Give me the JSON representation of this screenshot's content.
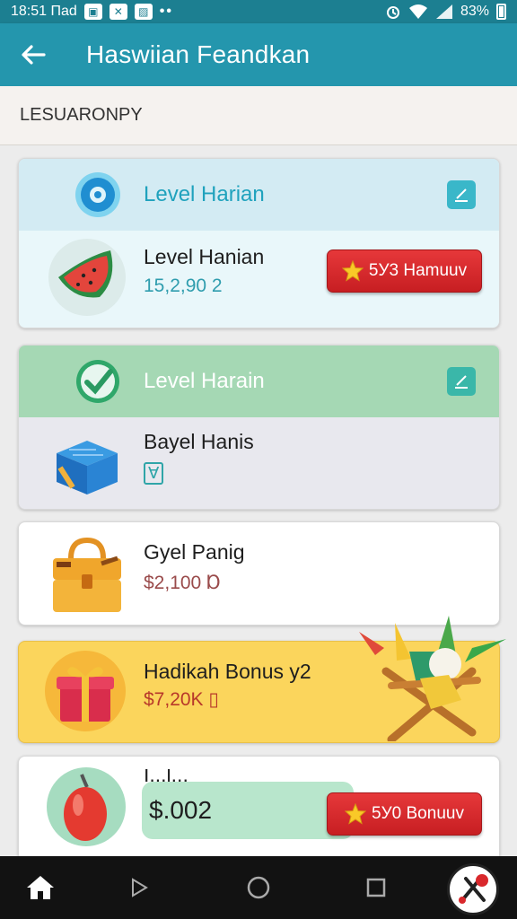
{
  "status_bar": {
    "time": "18:51 Пad",
    "notif_icons": [
      "image-icon",
      "x-icon",
      "photo-icon"
    ],
    "dots": "••",
    "battery_text": "83%"
  },
  "app_bar": {
    "title": "Haswiian Feandkan"
  },
  "section": {
    "title": "LESUARONPY"
  },
  "cards": [
    {
      "header": "Level Harian",
      "item_title": "Level Hanian",
      "item_sub": "15,2,90 2",
      "button_label": "5У3 Hamuuv",
      "colors": {
        "header_bg": "#d3ebf3",
        "body_bg": "#e9f7fa",
        "title": "#1fa2bd"
      }
    },
    {
      "header": "Level Harain",
      "item_title": "Bayel Hanis",
      "item_badge": "Ɐ",
      "colors": {
        "header_bg": "#a5d8b4",
        "body_bg": "#e8e8ee",
        "title": "#ffffff"
      }
    },
    {
      "item_title": "Gyel Panig",
      "item_sub": "$2,100 Ɒ"
    },
    {
      "item_title": "Hadikah Bonus y2",
      "item_sub": "$7,20K ▯",
      "colors": {
        "bg": "#fbd55c",
        "sub": "#b8382a"
      }
    },
    {
      "item_title_partial": "I...l...",
      "amount": "$.002",
      "button_label": "5У0 Bonuuv"
    }
  ],
  "nav": {
    "items": [
      "home-icon",
      "play-icon",
      "circle-icon",
      "square-icon"
    ]
  },
  "accent_colors": {
    "app_bar": "#2496ad",
    "status_bar": "#1c7f91",
    "button_red": "#d9282c",
    "star": "#f9c928"
  }
}
